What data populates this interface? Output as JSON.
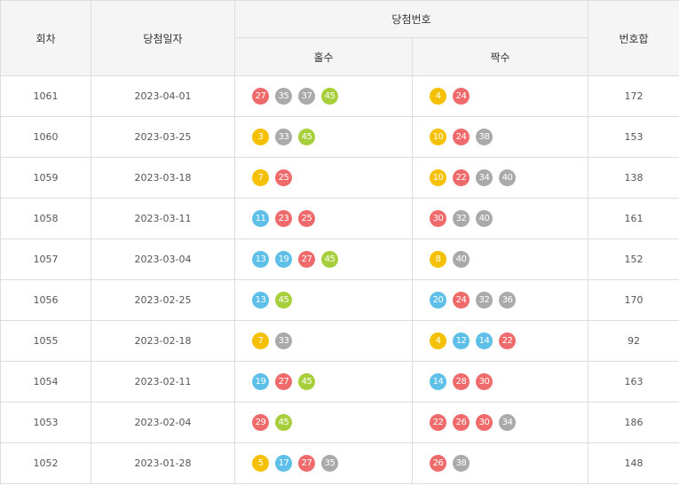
{
  "header": {
    "round": "회차",
    "date": "당첨일자",
    "numbers": "당첨번호",
    "odd": "홀수",
    "even": "짝수",
    "sum": "번호합"
  },
  "colors": {
    "yellow": "#f5c000",
    "blue": "#5ec0e8",
    "red": "#ef6b6b",
    "gray": "#aaaaaa",
    "green": "#a7cf3c"
  },
  "rows": [
    {
      "round": "1061",
      "date": "2023-04-01",
      "odd": [
        27,
        35,
        37,
        45
      ],
      "even": [
        4,
        24
      ],
      "sum": "172"
    },
    {
      "round": "1060",
      "date": "2023-03-25",
      "odd": [
        3,
        33,
        45
      ],
      "even": [
        10,
        24,
        38
      ],
      "sum": "153"
    },
    {
      "round": "1059",
      "date": "2023-03-18",
      "odd": [
        7,
        25
      ],
      "even": [
        10,
        22,
        34,
        40
      ],
      "sum": "138"
    },
    {
      "round": "1058",
      "date": "2023-03-11",
      "odd": [
        11,
        23,
        25
      ],
      "even": [
        30,
        32,
        40
      ],
      "sum": "161"
    },
    {
      "round": "1057",
      "date": "2023-03-04",
      "odd": [
        13,
        19,
        27,
        45
      ],
      "even": [
        8,
        40
      ],
      "sum": "152"
    },
    {
      "round": "1056",
      "date": "2023-02-25",
      "odd": [
        13,
        45
      ],
      "even": [
        20,
        24,
        32,
        36
      ],
      "sum": "170"
    },
    {
      "round": "1055",
      "date": "2023-02-18",
      "odd": [
        7,
        33
      ],
      "even": [
        4,
        12,
        14,
        22
      ],
      "sum": "92"
    },
    {
      "round": "1054",
      "date": "2023-02-11",
      "odd": [
        19,
        27,
        45
      ],
      "even": [
        14,
        28,
        30
      ],
      "sum": "163"
    },
    {
      "round": "1053",
      "date": "2023-02-04",
      "odd": [
        29,
        45
      ],
      "even": [
        22,
        26,
        30,
        34
      ],
      "sum": "186"
    },
    {
      "round": "1052",
      "date": "2023-01-28",
      "odd": [
        5,
        17,
        27,
        35
      ],
      "even": [
        26,
        38
      ],
      "sum": "148"
    }
  ]
}
